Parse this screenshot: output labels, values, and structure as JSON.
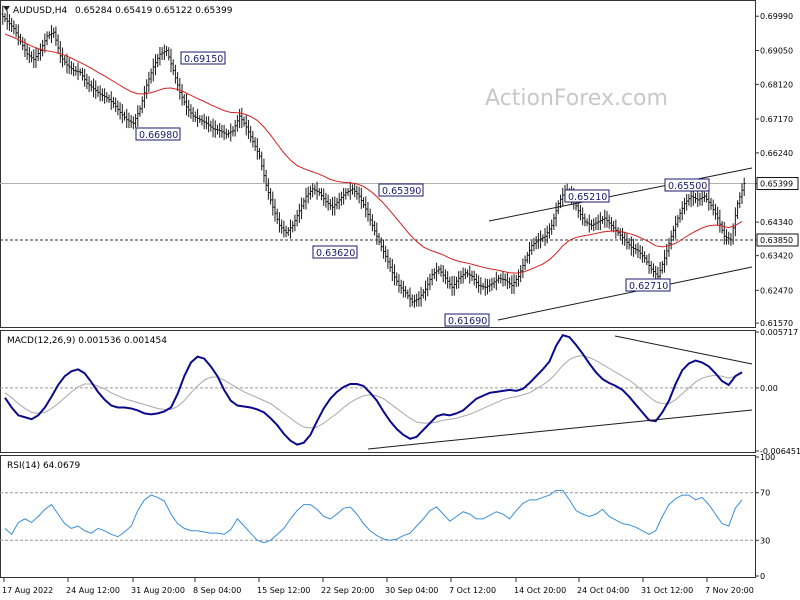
{
  "header": {
    "symbol_tf": "AUDUSD,H4",
    "ohlc": "0.65284 0.65419 0.65122 0.65399",
    "watermark": "ActionForex.com"
  },
  "colors": {
    "price_bars": "#1a1a1a",
    "sma": "#d42020",
    "macd_line": "#0a0a8c",
    "signal_line": "#a8a8a8",
    "rsi_line": "#3a8fd8",
    "trendline": "#1a1a1a",
    "label_border": "#1a1a6e",
    "label_text": "#1a1a6e"
  },
  "chart_data": [
    {
      "type": "candlestick",
      "panel": "price",
      "ylim": [
        0.6149,
        0.7038
      ],
      "y_ticks": [
        "0.69990",
        "0.69050",
        "0.68120",
        "0.67170",
        "0.66240",
        "0.65399",
        "0.64340",
        "0.63850",
        "0.63420",
        "0.62470",
        "0.61570"
      ],
      "current_price": "0.65399",
      "reference_level": "0.63850",
      "x_ticks": [
        "17 Aug 2022",
        "24 Aug 12:00",
        "31 Aug 20:00",
        "8 Sep 04:00",
        "15 Sep 12:00",
        "22 Sep 20:00",
        "30 Sep 04:00",
        "7 Oct 12:00",
        "14 Oct 20:00",
        "24 Oct 04:00",
        "31 Oct 12:00",
        "7 Nov 20:00"
      ],
      "annotations": [
        "0.69150",
        "0.66980",
        "0.65390",
        "0.63620",
        "0.61690",
        "0.65210",
        "0.65500",
        "0.62710"
      ],
      "close_series": [
        0.6985,
        0.6965,
        0.693,
        0.6895,
        0.688,
        0.6905,
        0.6945,
        0.6955,
        0.689,
        0.6865,
        0.685,
        0.6845,
        0.6815,
        0.68,
        0.6785,
        0.6775,
        0.676,
        0.6735,
        0.6715,
        0.6705,
        0.6745,
        0.681,
        0.686,
        0.6895,
        0.6905,
        0.685,
        0.679,
        0.675,
        0.6725,
        0.6715,
        0.6705,
        0.669,
        0.6685,
        0.6675,
        0.6685,
        0.6725,
        0.6695,
        0.6655,
        0.6615,
        0.6535,
        0.6475,
        0.6425,
        0.6405,
        0.6425,
        0.6465,
        0.6505,
        0.6525,
        0.6515,
        0.649,
        0.6475,
        0.6495,
        0.6515,
        0.6525,
        0.6505,
        0.647,
        0.6425,
        0.638,
        0.634,
        0.6295,
        0.626,
        0.624,
        0.6215,
        0.6225,
        0.625,
        0.629,
        0.6305,
        0.628,
        0.6255,
        0.628,
        0.6295,
        0.6285,
        0.626,
        0.6255,
        0.6265,
        0.628,
        0.6275,
        0.626,
        0.6285,
        0.633,
        0.637,
        0.6385,
        0.6395,
        0.6425,
        0.6485,
        0.652,
        0.6505,
        0.6465,
        0.6435,
        0.6425,
        0.6435,
        0.6445,
        0.6425,
        0.6405,
        0.6385,
        0.6365,
        0.6355,
        0.6335,
        0.6305,
        0.6285,
        0.6335,
        0.6395,
        0.6445,
        0.6485,
        0.6505,
        0.6495,
        0.6505,
        0.648,
        0.6445,
        0.6395,
        0.6385,
        0.6485,
        0.654
      ],
      "sma_series": [
        0.695,
        0.6943,
        0.6935,
        0.6926,
        0.6917,
        0.691,
        0.6905,
        0.6902,
        0.6898,
        0.6892,
        0.6884,
        0.6875,
        0.6866,
        0.6856,
        0.6845,
        0.6835,
        0.6824,
        0.6813,
        0.6802,
        0.6792,
        0.6786,
        0.6786,
        0.6789,
        0.6795,
        0.6801,
        0.6802,
        0.6798,
        0.6791,
        0.6782,
        0.6773,
        0.6765,
        0.6756,
        0.6748,
        0.674,
        0.6735,
        0.6734,
        0.6731,
        0.6724,
        0.6713,
        0.6695,
        0.6673,
        0.6648,
        0.6624,
        0.6604,
        0.6589,
        0.6581,
        0.6574,
        0.6568,
        0.656,
        0.6551,
        0.6546,
        0.6543,
        0.6542,
        0.6539,
        0.6532,
        0.652,
        0.6504,
        0.6486,
        0.6465,
        0.6443,
        0.6421,
        0.6399,
        0.6381,
        0.6366,
        0.6357,
        0.6351,
        0.6344,
        0.6335,
        0.6328,
        0.6324,
        0.632,
        0.6315,
        0.631,
        0.6306,
        0.6303,
        0.6299,
        0.6295,
        0.6294,
        0.6297,
        0.6303,
        0.6311,
        0.6319,
        0.6331,
        0.6348,
        0.6369,
        0.6384,
        0.6392,
        0.6396,
        0.6399,
        0.6403,
        0.6407,
        0.6409,
        0.641,
        0.6407,
        0.6403,
        0.6397,
        0.6389,
        0.638,
        0.6369,
        0.6366,
        0.6369,
        0.6376,
        0.6387,
        0.6399,
        0.6409,
        0.6418,
        0.6424,
        0.6426,
        0.6423,
        0.6419,
        0.6425,
        0.6436
      ]
    },
    {
      "type": "line",
      "panel": "macd",
      "title": "MACD(12,26,9) 0.001536 0.001454",
      "ylim": [
        -0.00645,
        0.00572
      ],
      "y_ticks": [
        "0.005717",
        "0.00",
        "-0.006451"
      ],
      "series": [
        {
          "values": [
            -0.001,
            -0.002,
            -0.0028,
            -0.003,
            -0.0032,
            -0.0028,
            -0.002,
            -0.0009,
            0.0003,
            0.0012,
            0.0017,
            0.0019,
            0.0015,
            0.0006,
            -0.0004,
            -0.0012,
            -0.0018,
            -0.002,
            -0.002,
            -0.0021,
            -0.0023,
            -0.0026,
            -0.0027,
            -0.0026,
            -0.0024,
            -0.002,
            -0.0006,
            0.0012,
            0.0026,
            0.0032,
            0.003,
            0.0022,
            0.0012,
            -0.0002,
            -0.0013,
            -0.0018,
            -0.0019,
            -0.002,
            -0.0022,
            -0.0025,
            -0.0031,
            -0.0038,
            -0.0047,
            -0.0054,
            -0.0058,
            -0.0056,
            -0.0048,
            -0.0034,
            -0.0021,
            -0.0011,
            -0.0004,
            0.0001,
            0.0004,
            0.0004,
            0.0002,
            -0.0005,
            -0.0013,
            -0.0024,
            -0.0034,
            -0.0042,
            -0.0048,
            -0.0052,
            -0.005,
            -0.0043,
            -0.0036,
            -0.0029,
            -0.0027,
            -0.0028,
            -0.0026,
            -0.0023,
            -0.0017,
            -0.0011,
            -0.0008,
            -0.0005,
            -0.0004,
            -0.0003,
            -0.0002,
            -0.0003,
            -0.0001,
            0.0005,
            0.0012,
            0.0019,
            0.0027,
            0.0043,
            0.0054,
            0.0052,
            0.0044,
            0.0035,
            0.0025,
            0.0016,
            0.0009,
            0.0005,
            0.0002,
            -0.0002,
            -0.0009,
            -0.0017,
            -0.0025,
            -0.0033,
            -0.0034,
            -0.0025,
            -0.0013,
            0.0004,
            0.0018,
            0.0025,
            0.0028,
            0.0026,
            0.0022,
            0.0015,
            0.0007,
            0.0003,
            0.0012,
            0.0016
          ]
        },
        {
          "values": [
            -0.0005,
            -0.001,
            -0.0016,
            -0.0021,
            -0.0025,
            -0.0026,
            -0.0025,
            -0.0021,
            -0.0016,
            -0.001,
            -0.0004,
            0.0001,
            0.0004,
            0.0004,
            0.0002,
            -0.0001,
            -0.0005,
            -0.0008,
            -0.0011,
            -0.0013,
            -0.0015,
            -0.0017,
            -0.0019,
            -0.0021,
            -0.0022,
            -0.0022,
            -0.0019,
            -0.0013,
            -0.0005,
            0.0002,
            0.0008,
            0.0011,
            0.0011,
            0.0008,
            0.0004,
            0.0,
            -0.0004,
            -0.0007,
            -0.001,
            -0.0013,
            -0.0016,
            -0.0021,
            -0.0026,
            -0.0031,
            -0.0036,
            -0.004,
            -0.0041,
            -0.004,
            -0.0036,
            -0.0031,
            -0.0026,
            -0.002,
            -0.0015,
            -0.0011,
            -0.0008,
            -0.0007,
            -0.0008,
            -0.0011,
            -0.0016,
            -0.0021,
            -0.0026,
            -0.0031,
            -0.0035,
            -0.0036,
            -0.0036,
            -0.0035,
            -0.0033,
            -0.0032,
            -0.0031,
            -0.0029,
            -0.0027,
            -0.0024,
            -0.0021,
            -0.0018,
            -0.0015,
            -0.0012,
            -0.001,
            -0.0009,
            -0.0007,
            -0.0005,
            -0.0001,
            0.0003,
            0.0008,
            0.0015,
            0.0023,
            0.0029,
            0.0032,
            0.0033,
            0.0031,
            0.0028,
            0.0024,
            0.002,
            0.0016,
            0.0012,
            0.0008,
            0.0003,
            -0.0003,
            -0.0009,
            -0.0014,
            -0.0016,
            -0.0016,
            -0.0012,
            -0.0006,
            0.0,
            0.0006,
            0.001,
            0.0012,
            0.0013,
            0.0012,
            0.001,
            0.0012,
            0.0015
          ]
        }
      ]
    },
    {
      "type": "line",
      "panel": "rsi",
      "title": "RSI(14) 64.0679",
      "ylim": [
        0,
        100
      ],
      "y_ticks": [
        "100",
        "70",
        "30",
        "0"
      ],
      "levels": [
        70,
        30
      ],
      "values": [
        40,
        35,
        45,
        48,
        45,
        50,
        56,
        60,
        52,
        44,
        40,
        42,
        38,
        36,
        40,
        38,
        35,
        33,
        37,
        42,
        55,
        64,
        68,
        66,
        63,
        52,
        44,
        40,
        38,
        38,
        37,
        36,
        36,
        35,
        39,
        48,
        42,
        36,
        30,
        28,
        30,
        35,
        40,
        48,
        55,
        60,
        60,
        56,
        50,
        48,
        52,
        57,
        58,
        52,
        44,
        38,
        34,
        31,
        30,
        31,
        34,
        36,
        42,
        48,
        55,
        58,
        52,
        46,
        50,
        54,
        52,
        48,
        48,
        51,
        54,
        52,
        48,
        55,
        61,
        64,
        64,
        66,
        68,
        72,
        72,
        64,
        55,
        52,
        50,
        52,
        56,
        50,
        47,
        44,
        43,
        41,
        38,
        35,
        38,
        50,
        60,
        65,
        68,
        68,
        64,
        66,
        60,
        52,
        44,
        42,
        57,
        64
      ]
    }
  ]
}
